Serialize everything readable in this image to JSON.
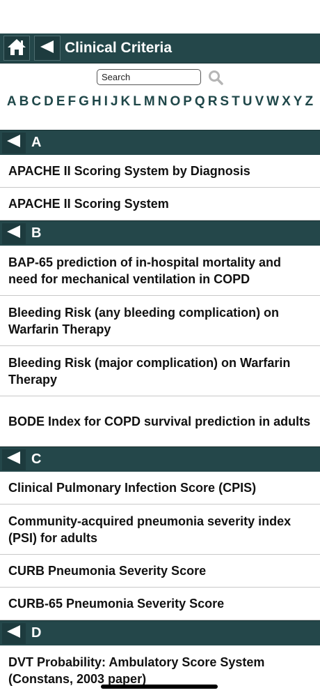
{
  "header": {
    "title": "Clinical Criteria"
  },
  "search": {
    "placeholder": "Search"
  },
  "alphabet": [
    "A",
    "B",
    "C",
    "D",
    "E",
    "F",
    "G",
    "H",
    "I",
    "J",
    "K",
    "L",
    "M",
    "N",
    "O",
    "P",
    "Q",
    "R",
    "S",
    "T",
    "U",
    "V",
    "W",
    "X",
    "Y",
    "Z"
  ],
  "sections": [
    {
      "letter": "A",
      "items": [
        "APACHE II Scoring System by Diagnosis",
        "APACHE II Scoring System"
      ]
    },
    {
      "letter": "B",
      "items": [
        "BAP-65 prediction of in-hospital mortality and need for mechanical ventilation in COPD",
        "Bleeding Risk (any bleeding complication) on Warfarin Therapy",
        "Bleeding Risk (major complication) on Warfarin Therapy",
        "BODE Index for COPD survival prediction in adults"
      ]
    },
    {
      "letter": "C",
      "items": [
        "Clinical Pulmonary Infection Score (CPIS)",
        "Community-acquired pneumonia severity index (PSI) for adults",
        "CURB Pneumonia Severity Score",
        "CURB-65 Pneumonia Severity Score"
      ]
    },
    {
      "letter": "D",
      "items": [
        "DVT Probability: Ambulatory Score System (Constans, 2003 paper)"
      ]
    }
  ],
  "colors": {
    "header_bg": "#24474a",
    "letter_color": "#1f4749"
  },
  "icons": {
    "home": "home-icon",
    "back": "back-arrow-icon",
    "search": "magnifier-icon"
  }
}
